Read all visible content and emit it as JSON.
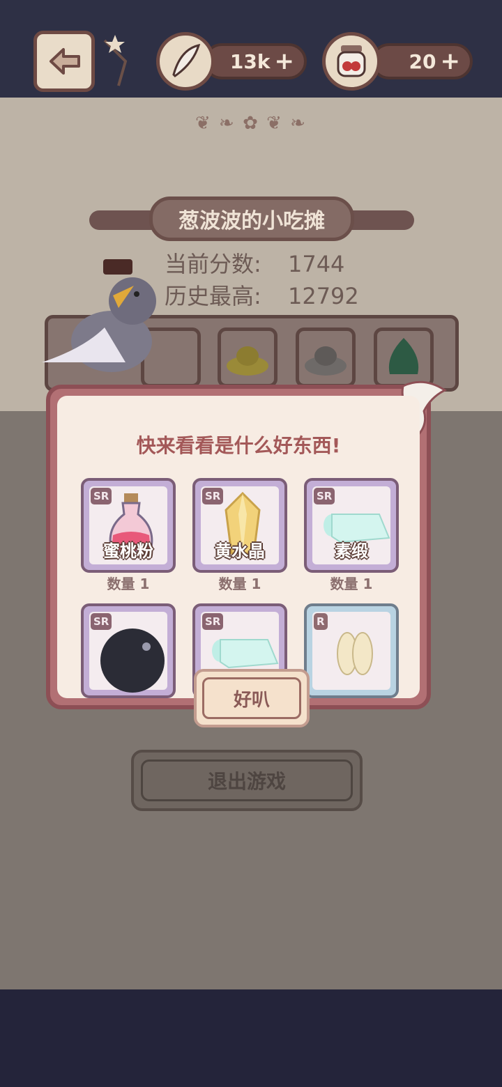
{
  "topbar": {
    "feather_count": "13k",
    "jar_count": "20",
    "plus": "+"
  },
  "stall": {
    "title": "葱波波的小吃摊",
    "current_score_label": "当前分数:",
    "current_score": "1744",
    "best_score_label": "历史最高:",
    "best_score": "12792"
  },
  "dialog": {
    "title": "快来看看是什么好东西!",
    "items": [
      {
        "rarity": "SR",
        "name": "蜜桃粉",
        "qty": "数量 1"
      },
      {
        "rarity": "SR",
        "name": "黄水晶",
        "qty": "数量 1"
      },
      {
        "rarity": "SR",
        "name": "素缎",
        "qty": "数量 1"
      },
      {
        "rarity": "SR",
        "name": "",
        "qty": ""
      },
      {
        "rarity": "SR",
        "name": "",
        "qty": ""
      },
      {
        "rarity": "R",
        "name": "",
        "qty": ""
      }
    ],
    "ok_label": "好叭"
  },
  "exit_label": "退出游戏",
  "colors": {
    "accent": "#a35858",
    "paper": "#bdb3a6",
    "dialog_frame": "#b27074",
    "sr_card": "#c3aed6",
    "r_card": "#b9d3e2"
  }
}
